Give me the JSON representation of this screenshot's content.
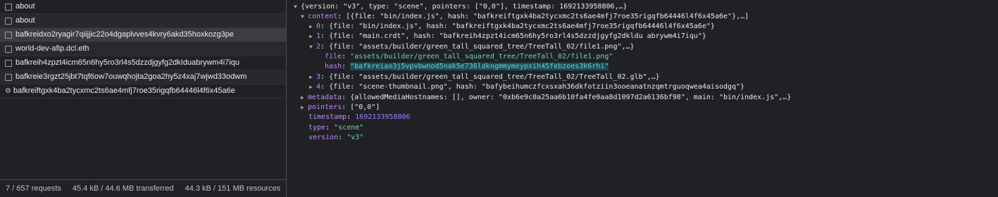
{
  "requests": [
    {
      "label": "about",
      "checkbox": true,
      "gear": false
    },
    {
      "label": "about",
      "checkbox": true,
      "gear": false
    },
    {
      "label": "bafkreidxo2ryagir7qiijjic22o4dgaplvves4kvry6akd35hoxkozg3pe",
      "checkbox": true,
      "gear": false
    },
    {
      "label": "world-dev-afip.dcl.eth",
      "checkbox": true,
      "gear": false
    },
    {
      "label": "bafkreih4zpzt4icm65n6hy5ro3rl4s5dzzdjgyfg2dkIduabrywm4i7iqu",
      "checkbox": true,
      "gear": false
    },
    {
      "label": "bafkreie3rgzt25jbt7tqf6ow7ouwqhojta2goa2hy5z4xaj7wjwd33odwm",
      "checkbox": true,
      "gear": false
    },
    {
      "label": "bafkreiftgxk4ba2tycxmc2ts6ae4mfj7roe35rigqfb64446l4f6x45a6e",
      "checkbox": false,
      "gear": true
    }
  ],
  "status": {
    "requests": "7 / 657 requests",
    "transferred": "45.4 kB / 44.6 MB transferred",
    "resources": "44.3 kB / 151 MB resources"
  },
  "preview": {
    "root": "{version: \"v3\", type: \"scene\", pointers: [\"0,0\"], timestamp: 1692133958806,…}",
    "content_key": "content",
    "content_val": ": [{file: \"bin/index.js\", hash: \"bafkreiftgxk4ba2tycxmc2ts6ae4mfj7roe35rigqfb64446l4f6x45a6e\"},…]",
    "item0_key": "0",
    "item0_val": ": {file: \"bin/index.js\", hash: \"bafkreiftgxk4ba2tycxmc2ts6ae4mfj7roe35rigqfb64446l4f6x45a6e\"}",
    "item1_key": "1",
    "item1_val": ": {file: \"main.crdt\", hash: \"bafkreih4zpzt4icm65n6hy5ro3rl4s5dzzdjgyfg2dkldu abrywm4i7iqu\"}",
    "item2_key": "2",
    "item2_val": ": {file: \"assets/builder/green_tall_squared_tree/TreeTall_02/file1.png\",…}",
    "file_key": "file",
    "file_val": "\"assets/builder/green_tall_squared_tree/TreeTall_02/file1.png\"",
    "hash_key": "hash",
    "hash_val": "\"bafkreiao3j5vpvbwnod5nak5e736ldkngmmymeypxih45febzoes3k6rhi\"",
    "item3_key": "3",
    "item3_val": ": {file: \"assets/builder/green_tall_squared_tree/TreeTall_02/TreeTall_02.glb\",…}",
    "item4_key": "4",
    "item4_val": ": {file: \"scene-thumbnail.png\", hash: \"bafybeihumczfcxsxah36dkfotziin3ooeanatnzqmtrguoqwea4aisodgq\"}",
    "metadata_key": "metadata",
    "metadata_val": ": {allowedMediaHostnames: [], owner: \"0xb6e9c0a25aa6b10fa4fe0aa8d1097d2a6136bf98\", main: \"bin/index.js\",…}",
    "pointers_key": "pointers",
    "pointers_val": ": [\"0,0\"]",
    "timestamp_key": "timestamp",
    "timestamp_val": "1692133958806",
    "type_key": "type",
    "type_val": "\"scene\"",
    "version_key": "version",
    "version_val": "\"v3\""
  },
  "colors": {
    "background": "#202124",
    "selected_row": "#3c3d40",
    "string": "#6fd0c5",
    "key": "#9cb5ff",
    "number": "#9980ff"
  }
}
